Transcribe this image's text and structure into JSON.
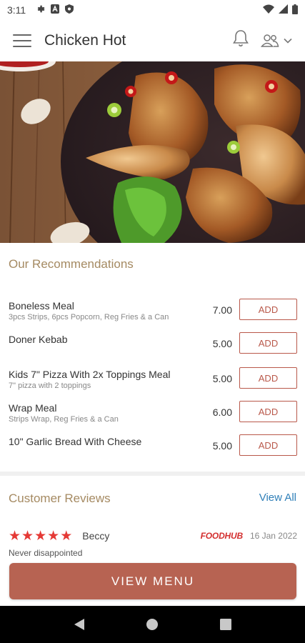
{
  "status_bar": {
    "time": "3:11"
  },
  "app_bar": {
    "title": "Chicken Hot"
  },
  "recommendations": {
    "title": "Our Recommendations",
    "items": [
      {
        "name": "Boneless Meal",
        "description": "3pcs Strips, 6pcs Popcorn, Reg Fries & a Can",
        "price": "7.00",
        "action": "ADD"
      },
      {
        "name": "Doner Kebab",
        "description": "",
        "price": "5.00",
        "action": "ADD"
      },
      {
        "name": "Kids 7\" Pizza With 2x Toppings Meal",
        "description": "7\" pizza with 2 toppings",
        "price": "5.00",
        "action": "ADD"
      },
      {
        "name": "Wrap Meal",
        "description": "Strips Wrap, Reg Fries  & a Can",
        "price": "6.00",
        "action": "ADD"
      },
      {
        "name": "10\" Garlic Bread With Cheese",
        "description": "",
        "price": "5.00",
        "action": "ADD"
      }
    ]
  },
  "reviews": {
    "title": "Customer Reviews",
    "view_all": "View All",
    "items": [
      {
        "reviewer": "Beccy",
        "rating": 5,
        "source": "FOODHUB",
        "date": "16 Jan 2022",
        "text": "Never disappointed"
      }
    ]
  },
  "view_menu": {
    "label": "VIEW MENU"
  },
  "colors": {
    "accent": "#b76352",
    "section_title": "#a58a62",
    "link": "#2f7fb8",
    "star": "#e53935"
  },
  "icons": {
    "status_left": [
      "settings-icon",
      "text-a-icon",
      "shield-icon"
    ],
    "status_right": [
      "wifi-icon",
      "signal-icon",
      "battery-icon"
    ],
    "app_bar": [
      "menu-icon",
      "bell-icon",
      "users-icon",
      "chevron-down-icon"
    ],
    "nav": [
      "back-icon",
      "home-icon",
      "recents-icon"
    ]
  }
}
